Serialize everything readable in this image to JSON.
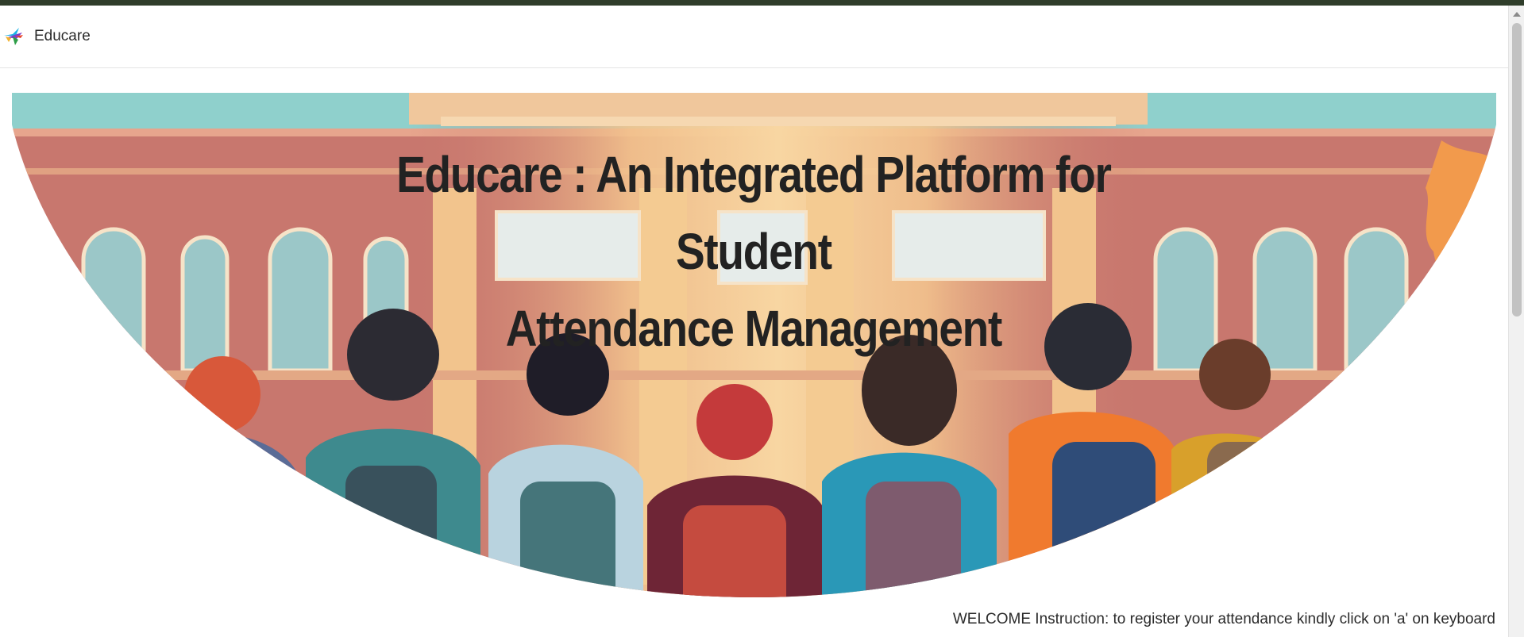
{
  "navbar": {
    "brand_name": "Educare",
    "logo_icon": "hummingbird-logo-icon"
  },
  "hero": {
    "title": "Educare : An Integrated Platform for\nStudent\nAttendance Management",
    "image_description_icon": "school-students-illustration"
  },
  "footer": {
    "instruction": "WELCOME Instruction: to register your attendance kindly click on 'a' on keyboard"
  },
  "colors": {
    "top_strip": "#2f3d2a",
    "sky": "#8fd0cc",
    "building": "#c8776e",
    "title_text": "#222222"
  }
}
